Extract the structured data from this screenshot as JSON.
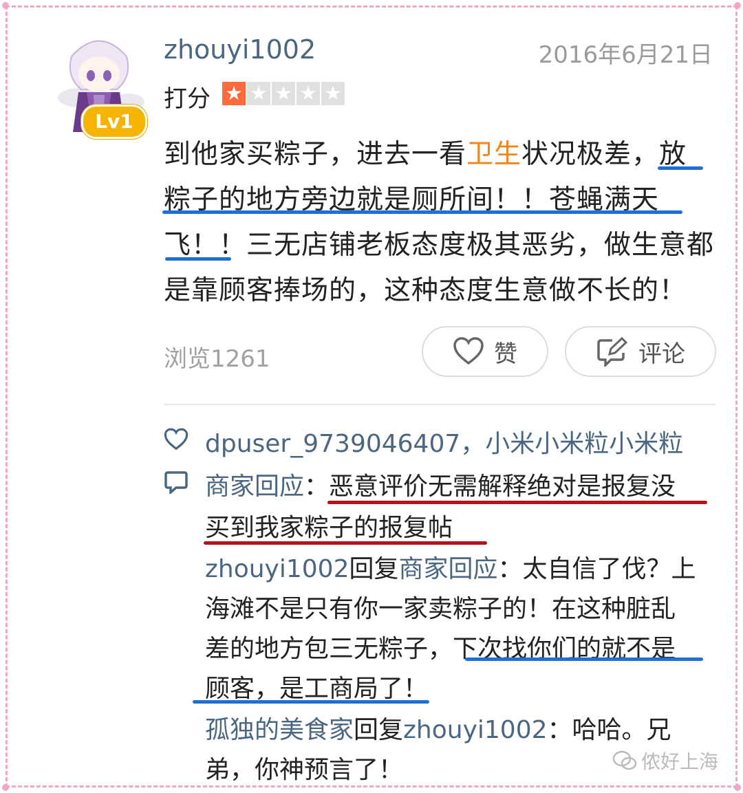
{
  "review": {
    "username": "zhouyi1002",
    "date": "2016年6月21日",
    "rating_label": "打分",
    "rating": {
      "value": 1,
      "max": 5
    },
    "level": "Lv1",
    "text_part1": "到他家买粽子，进去一看",
    "text_highlight": "卫生",
    "text_part2": "状况极差，放",
    "text_line2": "粽子的地方旁边就是厕所间！！苍蝇满天",
    "text_line3": "飞！！三无店铺老板态度极其恶劣，做生意都",
    "text_line4": "是靠顾客捧场的，这种态度生意做不长的！",
    "views": "浏览1261",
    "like_label": "赞",
    "comment_label": "评论"
  },
  "replies": {
    "likers": "dpuser_9739046407，小米小米粒小米粒",
    "merchant_name": "商家回应",
    "merchant_colon": "：",
    "merchant_line1": "恶意评价无需解释绝对是报复没",
    "merchant_line2": "买到我家粽子的报复帖",
    "r1_user": "zhouyi1002",
    "r1_reply_word": "回复",
    "r1_target": "商家回应",
    "r1_line1": "：太自信了伐？上",
    "r1_line2": "海滩不是只有你一家卖粽子的！在这种脏乱",
    "r1_line3a": "差的地方包三无粽子，",
    "r1_line3b": "下次找你们的就不是",
    "r1_line4": "顾客，是工商局了！",
    "r2_user": "孤独的美食家",
    "r2_reply_word": "回复",
    "r2_target": "zhouyi1002",
    "r2_line1": "：哈哈。兄",
    "r2_line2": "弟，你神预言了！"
  },
  "watermark": "侬好上海",
  "colors": {
    "frame": "#f3a6c4",
    "link": "#4a6680",
    "highlight": "#f08519",
    "underline_blue": "#1e6fd6",
    "underline_red": "#b3121b",
    "star": "#ff6a3d"
  }
}
